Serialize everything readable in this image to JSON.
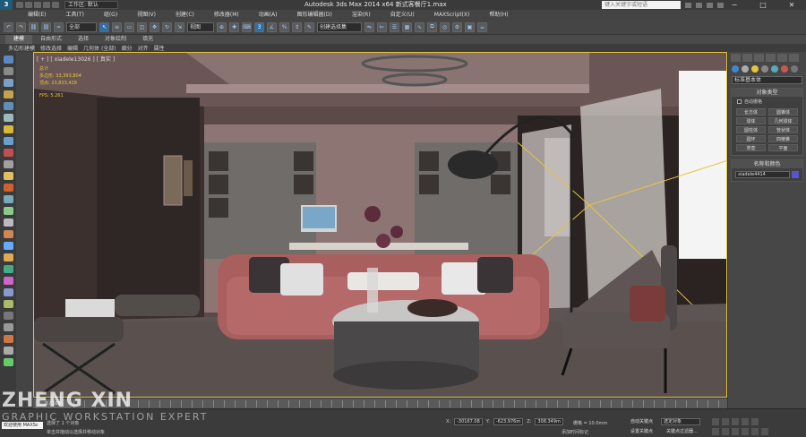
{
  "titlebar": {
    "app_icon": "3ds-max-logo-icon",
    "workspace": "工作区: 默认",
    "title": "Autodesk 3ds Max  2014 x64      新式客餐厅1.max",
    "search_placeholder": "键入关键字或短语",
    "minimize": "−",
    "maximize": "□",
    "close": "✕"
  },
  "menubar": {
    "items": [
      "编辑(E)",
      "工具(T)",
      "组(G)",
      "视图(V)",
      "创建(C)",
      "修改器(M)",
      "动画(A)",
      "图形编辑器(D)",
      "渲染(R)",
      "自定义(U)",
      "MAXScript(X)",
      "帮助(H)"
    ]
  },
  "toolbar": {
    "selection_filter": "全部",
    "coord_system": "视图",
    "named_selection": "创建选择集"
  },
  "ribbon": {
    "tabs": [
      "建模",
      "自由形式",
      "选择",
      "对象绘制",
      "填充"
    ],
    "active_tab": "建模",
    "sub_items": [
      "多边形建模",
      "修改选择",
      "编辑",
      "几何体 (全部)",
      "细分",
      "对齐",
      "属性"
    ]
  },
  "viewport": {
    "label": "[ + ] [ xiadele13026 ] [ 真实 ]",
    "stats_title": "总计",
    "stats_polys": "多边形:  33,393,804",
    "stats_verts": "顶点:    23,833,428",
    "stats_fps": "FPS:    5.261"
  },
  "command_panel": {
    "category": "标准基本体",
    "object_type_header": "对象类型",
    "autogrid": "自动栅格",
    "object_types": [
      "长方体",
      "圆锥体",
      "球体",
      "几何球体",
      "圆柱体",
      "管状体",
      "圆环",
      "四棱锥",
      "茶壶",
      "平面"
    ],
    "name_color_header": "名称和颜色",
    "object_name": "xiadele4414",
    "object_color": "#5b54c8"
  },
  "timeline": {
    "frame_display": "0 / 100",
    "ticks": [
      "0",
      "5",
      "10",
      "15",
      "20",
      "25",
      "30",
      "35",
      "40",
      "45",
      "50",
      "55",
      "60",
      "65",
      "70",
      "75",
      "80",
      "85",
      "90",
      "95",
      "100"
    ]
  },
  "statusbar": {
    "maxscript_label": "欢迎使用 MAXSc",
    "selection_info": "选择了 1 个对象",
    "prompt": "单击并拖动以选择并移动对象",
    "x_label": "X:",
    "x_value": "-30167.08",
    "y_label": "Y:",
    "y_value": "-623.976m",
    "z_label": "Z:",
    "z_value": "308.349m",
    "grid": "栅格 = 10.0mm",
    "add_time_tag": "添加时间标记",
    "auto_key": "自动关键点",
    "set_key": "设置关键点",
    "selected_object": "选定对象",
    "key_filter": "关键点过滤器..."
  },
  "watermark": {
    "line1": "ZHENG XIN",
    "line2": "GRAPHIC WORKSTATION EXPERT"
  }
}
